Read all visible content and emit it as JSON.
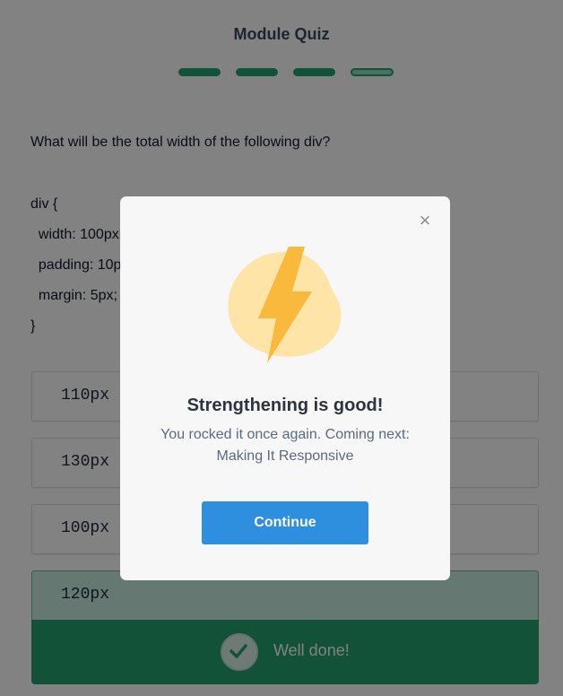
{
  "header": {
    "title": "Module Quiz"
  },
  "progress": {
    "total_steps": 4,
    "completed_steps": 3,
    "current_step": 4
  },
  "question": {
    "prompt": "What will be the total width of the following div?",
    "code_lines": [
      "div {",
      "  width: 100px;",
      "  padding: 10px;",
      "  margin: 5px;",
      "}"
    ]
  },
  "answers": [
    {
      "label": "110px",
      "state": "default"
    },
    {
      "label": "130px",
      "state": "default"
    },
    {
      "label": "100px",
      "state": "default"
    },
    {
      "label": "120px",
      "state": "selected-correct"
    }
  ],
  "result": {
    "text": "Well done!",
    "icon": "check-icon"
  },
  "modal": {
    "illustration": "lightning-bolt-icon",
    "title": "Strengthening is good!",
    "subtitle_line1": "You rocked it once again. Coming next:",
    "subtitle_line2": "Making It Responsive",
    "continue_label": "Continue",
    "close_icon": "close-icon"
  },
  "colors": {
    "brand_green": "#23a26e",
    "button_blue": "#2e8fde",
    "bolt_yellow": "#f9b93d",
    "blob_yellow": "#ffe4a8"
  }
}
